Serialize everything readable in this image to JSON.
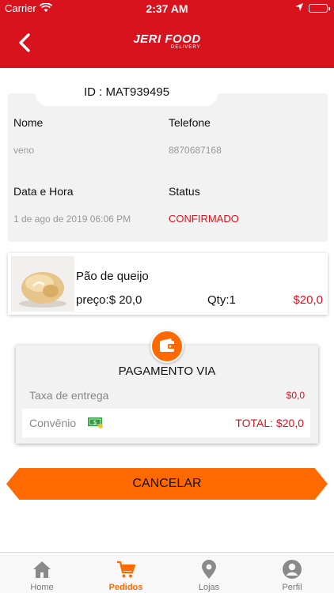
{
  "status_bar": {
    "carrier": "Carrier",
    "time": "2:37 AM"
  },
  "header": {
    "brand": "JERI FOOD",
    "brand_sub": "DELIVERY"
  },
  "order": {
    "id_label": "ID : MAT939495",
    "nome_label": "Nome",
    "nome_value": "veno",
    "telefone_label": "Telefone",
    "telefone_value": "8870687168",
    "data_label": "Data e Hora",
    "data_value": "1 de ago de 2019 06:06 PM",
    "status_label": "Status",
    "status_value": "CONFIRMADO"
  },
  "product": {
    "name": "Pão de queijo",
    "price": "preço:$ 20,0",
    "qty": "Qty:1",
    "total": "$20,0"
  },
  "payment": {
    "title": "PAGAMENTO VIA",
    "taxa_label": "Taxa de entrega",
    "taxa_value": "$0,0",
    "method_label": "Convênio",
    "total": "TOTAL: $20,0"
  },
  "actions": {
    "cancel_label": "CANCELAR"
  },
  "tabs": [
    {
      "label": "Home",
      "icon": "home-icon"
    },
    {
      "label": "Pedidos",
      "icon": "cart-icon",
      "active": true
    },
    {
      "label": "Lojas",
      "icon": "location-pin-icon"
    },
    {
      "label": "Perfil",
      "icon": "user-icon"
    }
  ],
  "colors": {
    "brand_red": "#d9131e",
    "accent_orange": "#ff6a00"
  }
}
